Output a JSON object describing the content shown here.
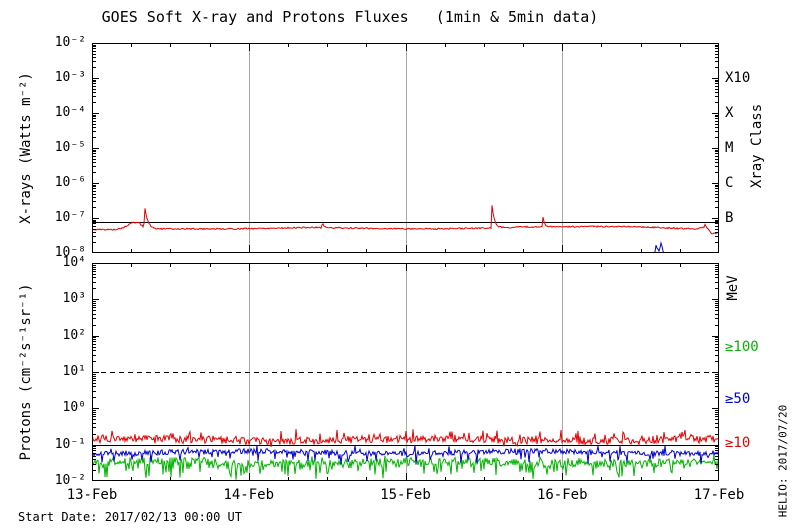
{
  "header": {
    "title": "GOES Soft X-ray and Protons Fluxes   (1min & 5min data)"
  },
  "footer": {
    "text": "Start Date: 2017/02/13 00:00 UT"
  },
  "credit": {
    "text": "HELIO: 2017/07/20"
  },
  "chart_data": {
    "type": "line",
    "title": "GOES Soft X-ray and Protons Fluxes   (1min & 5min data)",
    "start_date": "2017/02/13 00:00 UT",
    "x_axis": {
      "tick_labels": [
        "13-Feb",
        "14-Feb",
        "15-Feb",
        "16-Feb",
        "17-Feb"
      ],
      "days": 4,
      "minor_ticks_per_day": 4,
      "gridline_days": [
        1,
        2,
        3
      ],
      "gridline_color": "#a8a8a8"
    },
    "panels": [
      {
        "id": "xray",
        "ylabel": "X-rays (Watts m⁻²)",
        "y_log_top": -2,
        "y_log_bottom": -8,
        "y_tick_labels": [
          "10⁻²",
          "10⁻³",
          "10⁻⁴",
          "10⁻⁵",
          "10⁻⁶",
          "10⁻⁷",
          "10⁻⁸"
        ],
        "right_axis_label": "Xray Class",
        "right_tick_labels": [
          {
            "text": "X10",
            "log": -3,
            "color": "#000000"
          },
          {
            "text": "X",
            "log": -4,
            "color": "#000000"
          },
          {
            "text": "M",
            "log": -5,
            "color": "#000000"
          },
          {
            "text": "C",
            "log": -6,
            "color": "#000000"
          },
          {
            "text": "B",
            "log": -7,
            "color": "#000000"
          }
        ],
        "ref_lines": [
          {
            "log": -7.1,
            "style": "solid",
            "color": "#000000"
          }
        ],
        "series": [
          {
            "name": "xray-short-channel",
            "color": "#0000cc",
            "seed": 21,
            "noise": 0.04,
            "keypoints": [
              [
                0,
                -8.6
              ],
              [
                3.55,
                -8.6
              ],
              [
                3.585,
                -8.05
              ],
              [
                3.6,
                -7.78
              ],
              [
                3.615,
                -7.95
              ],
              [
                3.63,
                -7.72
              ],
              [
                3.655,
                -8.15
              ],
              [
                3.68,
                -8.6
              ],
              [
                4,
                -8.6
              ]
            ],
            "spikes": []
          },
          {
            "name": "xray-long-channel",
            "color": "#e60000",
            "seed": 5,
            "noise": 0.02,
            "keypoints": [
              [
                0,
                -7.33
              ],
              [
                0.15,
                -7.33
              ],
              [
                0.2,
                -7.28
              ],
              [
                0.26,
                -7.13
              ],
              [
                0.3,
                -7.13
              ],
              [
                0.33,
                -7.27
              ],
              [
                0.4,
                -7.31
              ],
              [
                0.9,
                -7.31
              ],
              [
                1.4,
                -7.27
              ],
              [
                1.8,
                -7.3
              ],
              [
                2.2,
                -7.31
              ],
              [
                2.5,
                -7.29
              ],
              [
                2.7,
                -7.26
              ],
              [
                3.0,
                -7.25
              ],
              [
                3.4,
                -7.24
              ],
              [
                3.6,
                -7.27
              ],
              [
                3.75,
                -7.3
              ],
              [
                3.85,
                -7.31
              ],
              [
                3.91,
                -7.26
              ],
              [
                3.95,
                -7.45
              ],
              [
                4,
                -7.42
              ]
            ],
            "spikes": [
              {
                "day": 0.338,
                "peak": -6.72,
                "rise": 0.008,
                "decay": 0.018
              },
              {
                "day": 1.47,
                "peak": -7.13,
                "rise": 0.006,
                "decay": 0.01
              },
              {
                "day": 2.552,
                "peak": -6.62,
                "rise": 0.006,
                "decay": 0.015
              },
              {
                "day": 2.877,
                "peak": -6.97,
                "rise": 0.005,
                "decay": 0.01
              },
              {
                "day": 3.91,
                "peak": -7.18,
                "rise": 0.006,
                "decay": 0.012
              }
            ]
          }
        ]
      },
      {
        "id": "protons",
        "ylabel": "Protons (cm⁻²s⁻¹sr⁻¹)",
        "y_log_top": 4,
        "y_log_bottom": -2,
        "y_tick_labels": [
          "10⁴",
          "10³",
          "10²",
          "10¹",
          "10⁰",
          "10⁻¹",
          "10⁻²"
        ],
        "right_axis_label": "MeV",
        "right_tick_labels": [
          {
            "text": "≥100",
            "log": 1.7,
            "color": "#00b400"
          },
          {
            "text": "≥50",
            "log": 0.25,
            "color": "#0000cc"
          },
          {
            "text": "≥10",
            "log": -0.95,
            "color": "#e60000"
          }
        ],
        "ref_lines": [
          {
            "log": 1,
            "style": "dashed",
            "color": "#000000"
          },
          {
            "log": -1,
            "style": "solid",
            "color": "#000000"
          }
        ],
        "series": [
          {
            "name": "protons-ge-100MeV",
            "color": "#00b400",
            "seed": 13,
            "baseline": -1.48,
            "noise": 0.1,
            "spikes_rand": [
              {
                "p": 0.28,
                "depth": 0.4,
                "dir": -1
              },
              {
                "p": 0.05,
                "depth": 0.12,
                "dir": 1
              }
            ]
          },
          {
            "name": "protons-ge-50MeV",
            "color": "#0000cc",
            "seed": 11,
            "baseline": -1.21,
            "noise": 0.07,
            "spikes_rand": [
              {
                "p": 0.12,
                "depth": 0.28,
                "dir": -1
              },
              {
                "p": 0.06,
                "depth": 0.18,
                "dir": 1
              }
            ]
          },
          {
            "name": "protons-ge-10MeV",
            "color": "#e60000",
            "seed": 7,
            "baseline": -0.87,
            "noise": 0.1,
            "spikes_rand": [
              {
                "p": 0.15,
                "depth": 0.25,
                "dir": 1
              },
              {
                "p": 0.08,
                "depth": 0.12,
                "dir": -1
              }
            ]
          }
        ]
      }
    ]
  }
}
